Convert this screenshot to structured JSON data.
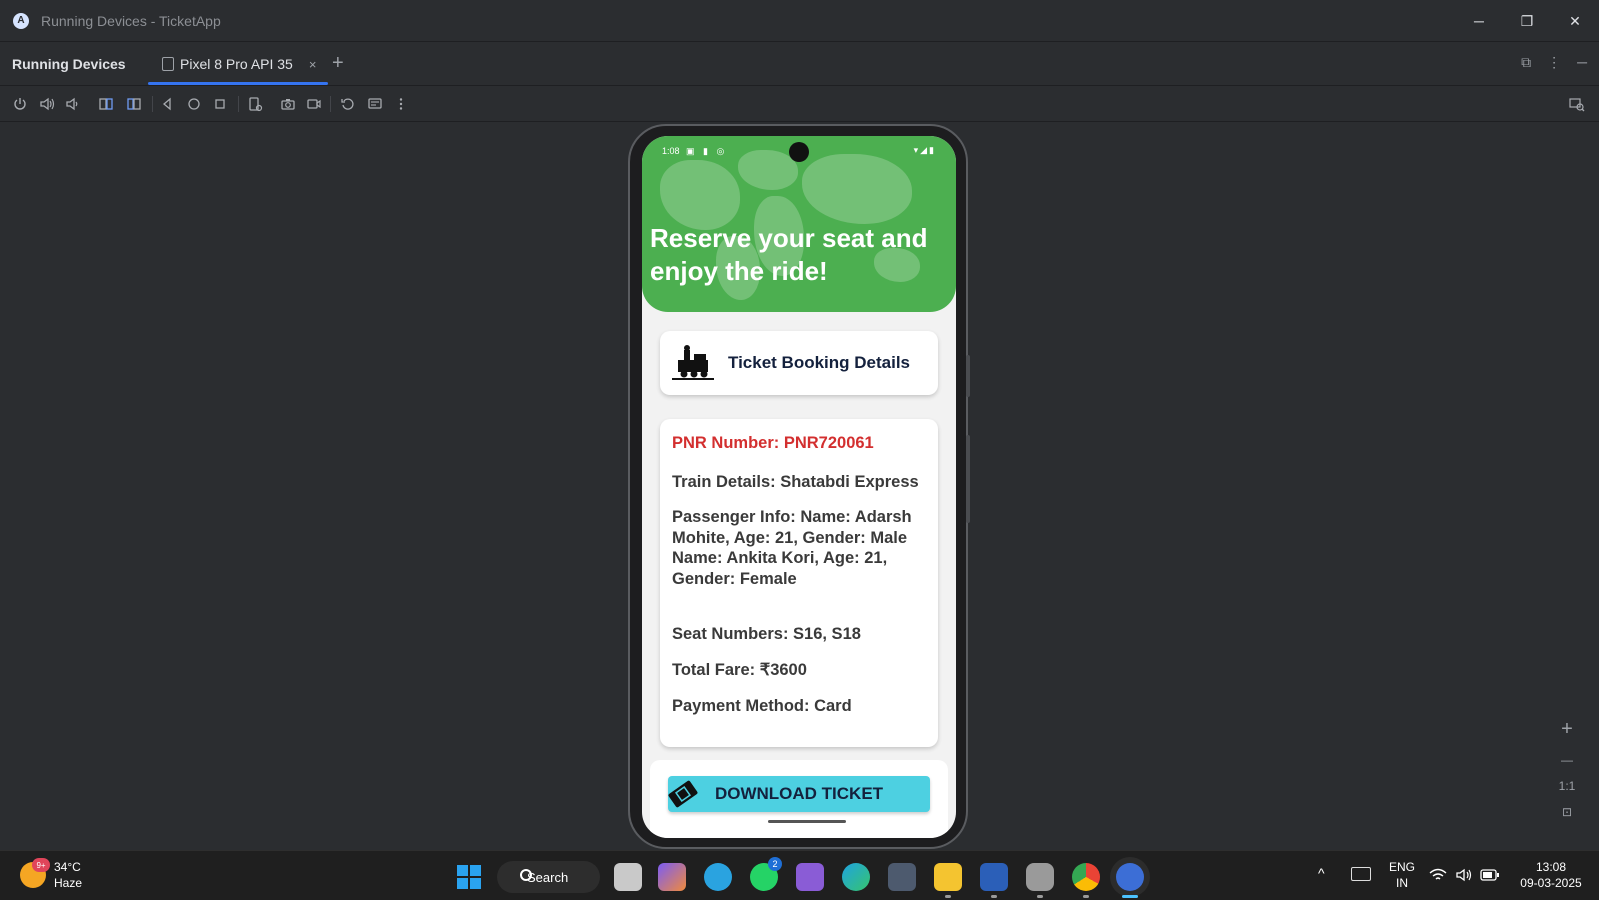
{
  "window": {
    "title": "Running Devices - TicketApp",
    "logo_glyph": "A",
    "controls": {
      "minimize": "─",
      "restore": "❐",
      "close": "✕"
    }
  },
  "tabs_bar": {
    "tool_title": "Running Devices",
    "tab_label": "Pixel 8 Pro API 35",
    "tab_close": "×",
    "add_tab": "+",
    "right_icons": [
      "⧉",
      "⋮",
      "─"
    ]
  },
  "toolbar": {
    "icons": [
      "power-icon",
      "volume-up-icon",
      "volume-down-icon",
      "rotate-left-icon",
      "rotate-right-icon",
      "back-icon",
      "home-icon",
      "overview-icon",
      "device-settings-icon",
      "screenshot-icon",
      "screen-record-icon",
      "reset-icon",
      "snapshot-icon",
      "more-icon",
      "zoom-search-icon"
    ]
  },
  "phone": {
    "status": {
      "time": "1:08",
      "left_icons": "▣ ▮ ◎",
      "right_icons": "▾◢▮"
    },
    "headline": "Reserve your seat and enjoy the ride!",
    "title_card": {
      "label": "Ticket Booking Details",
      "icon": "train-icon"
    },
    "details": {
      "pnr": "PNR Number: PNR720061",
      "train": "Train Details: Shatabdi Express",
      "passenger": "Passenger Info: Name: Adarsh Mohite, Age: 21, Gender: Male Name: Ankita Kori, Age: 21, Gender: Female",
      "seats": "Seat Numbers: S16, S18",
      "fare": "Total Fare: ₹3600",
      "payment": "Payment Method: Card"
    },
    "download_label": "DOWNLOAD TICKET",
    "colors": {
      "header": "#4caf50",
      "pnr": "#d32f2f",
      "button": "#4dd0e1"
    }
  },
  "zoom": {
    "plus": "+",
    "minus": "—",
    "one_to_one": "1:1",
    "fit": "⊡"
  },
  "taskbar": {
    "weather": {
      "temp": "34°C",
      "condition": "Haze",
      "badge": "9+"
    },
    "search_label": "Search",
    "whatsapp_badge": "2",
    "tray": {
      "chevron": "^",
      "lang_top": "ENG",
      "lang_bottom": "IN",
      "time": "13:08",
      "date": "09-03-2025"
    }
  }
}
